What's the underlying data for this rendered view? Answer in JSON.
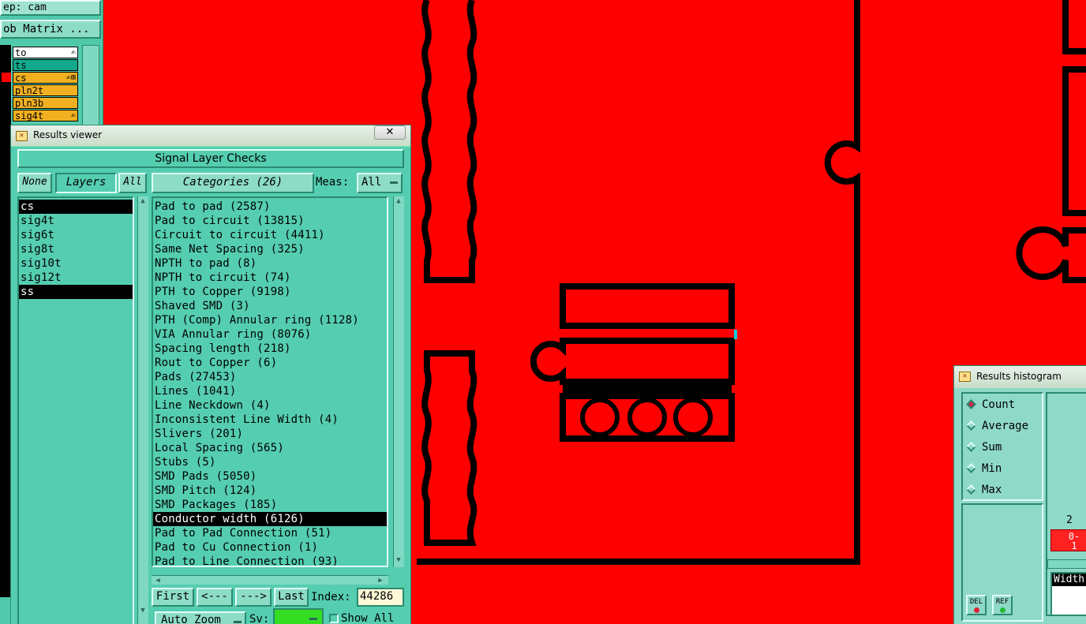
{
  "left_panel": {
    "step_field": "ep: cam",
    "matrix_button": "ob Matrix ...",
    "layers": [
      {
        "name": "to",
        "color": "#ffffff",
        "mark": "✍"
      },
      {
        "name": "ts",
        "color": "#12a98c",
        "mark": ""
      },
      {
        "name": "cs",
        "color": "#f0b020",
        "mark": "✍⊞"
      },
      {
        "name": "pln2t",
        "color": "#f0b020",
        "mark": ""
      },
      {
        "name": "pln3b",
        "color": "#f0b020",
        "mark": ""
      },
      {
        "name": "sig4t",
        "color": "#f0b020",
        "mark": "✍"
      }
    ]
  },
  "results_viewer": {
    "title": "Results viewer",
    "close_label": "✕",
    "header": "Signal Layer Checks",
    "none_label": "None",
    "layers_label": "Layers",
    "all_label": "All",
    "categories_label": "Categories (26)",
    "meas_label": "Meas:",
    "meas_value": "All",
    "layer_list": [
      {
        "text": "cs",
        "selected": true
      },
      {
        "text": "sig4t",
        "selected": false
      },
      {
        "text": "sig6t",
        "selected": false
      },
      {
        "text": "sig8t",
        "selected": false
      },
      {
        "text": "sig10t",
        "selected": false
      },
      {
        "text": "sig12t",
        "selected": false
      },
      {
        "text": "ss",
        "selected": true
      }
    ],
    "categories": [
      {
        "text": "Pad to pad (2587)",
        "selected": false
      },
      {
        "text": "Pad to circuit (13815)",
        "selected": false
      },
      {
        "text": "Circuit to circuit (4411)",
        "selected": false
      },
      {
        "text": "Same Net Spacing (325)",
        "selected": false
      },
      {
        "text": "NPTH to pad (8)",
        "selected": false
      },
      {
        "text": "NPTH to circuit (74)",
        "selected": false
      },
      {
        "text": "PTH to Copper (9198)",
        "selected": false
      },
      {
        "text": "Shaved SMD (3)",
        "selected": false
      },
      {
        "text": "PTH (Comp) Annular ring (1128)",
        "selected": false
      },
      {
        "text": "VIA Annular ring (8076)",
        "selected": false
      },
      {
        "text": "Spacing length (218)",
        "selected": false
      },
      {
        "text": "Rout to Copper (6)",
        "selected": false
      },
      {
        "text": "Pads (27453)",
        "selected": false
      },
      {
        "text": "Lines (1041)",
        "selected": false
      },
      {
        "text": "Line Neckdown (4)",
        "selected": false
      },
      {
        "text": "Inconsistent Line Width (4)",
        "selected": false
      },
      {
        "text": "Slivers (201)",
        "selected": false
      },
      {
        "text": "Local Spacing (565)",
        "selected": false
      },
      {
        "text": "Stubs (5)",
        "selected": false
      },
      {
        "text": "SMD Pads (5050)",
        "selected": false
      },
      {
        "text": "SMD Pitch (124)",
        "selected": false
      },
      {
        "text": "SMD Packages (185)",
        "selected": false
      },
      {
        "text": "Conductor width (6126)",
        "selected": true
      },
      {
        "text": "Pad to Pad Connection (51)",
        "selected": false
      },
      {
        "text": "Pad to Cu Connection (1)",
        "selected": false
      },
      {
        "text": "Pad to Line Connection (93)",
        "selected": false
      }
    ],
    "nav": {
      "first": "First",
      "prev": "<---",
      "next": "--->",
      "last": "Last",
      "index_label": "Index:",
      "index_value": "44286"
    },
    "auto_zoom_label": "Auto Zoom",
    "sv_label": "Sv:",
    "show_all_label": "Show All"
  },
  "histogram": {
    "title": "Results histogram",
    "modes": [
      {
        "label": "Count",
        "selected": true
      },
      {
        "label": "Average",
        "selected": false
      },
      {
        "label": "Sum",
        "selected": false
      },
      {
        "label": "Min",
        "selected": false
      },
      {
        "label": "Max",
        "selected": false
      }
    ],
    "bar_count": "2",
    "bar_label": "0-\n1",
    "width_label": "Width",
    "del_label": "DEL",
    "ref_label": "REF"
  }
}
